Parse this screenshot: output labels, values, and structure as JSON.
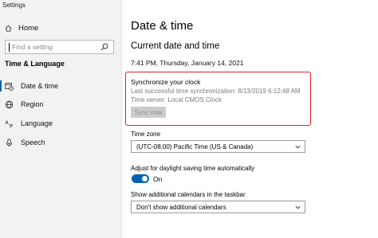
{
  "app": {
    "title": "Settings"
  },
  "sidebar": {
    "home_label": "Home",
    "search_placeholder": "Find a setting",
    "section_title": "Time & Language",
    "items": [
      {
        "label": "Date & time",
        "icon": "calendar-clock-icon",
        "active": true
      },
      {
        "label": "Region",
        "icon": "globe-icon",
        "active": false
      },
      {
        "label": "Language",
        "icon": "language-icon",
        "active": false
      },
      {
        "label": "Speech",
        "icon": "microphone-icon",
        "active": false
      }
    ]
  },
  "main": {
    "title": "Date & time",
    "subtitle": "Current date and time",
    "current_time": "7:41 PM, Thursday, January 14, 2021",
    "sync": {
      "title": "Synchronize your clock",
      "last_sync": "Last successful time synchronization: 8/13/2019 6:12:48 AM",
      "server": "Time server: Local CMOS Clock",
      "button_label": "Sync now"
    },
    "timezone": {
      "label": "Time zone",
      "value": "(UTC-08:00) Pacific Time (US & Canada)"
    },
    "dst": {
      "label": "Adjust for daylight saving time automatically",
      "toggle_state": "On"
    },
    "calendars": {
      "label": "Show additional calendars in the taskbar",
      "value": "Don't show additional calendars"
    }
  },
  "colors": {
    "accent": "#0063b1",
    "highlight_border": "#e0201d",
    "sidebar_bg": "#f2f2f2"
  }
}
